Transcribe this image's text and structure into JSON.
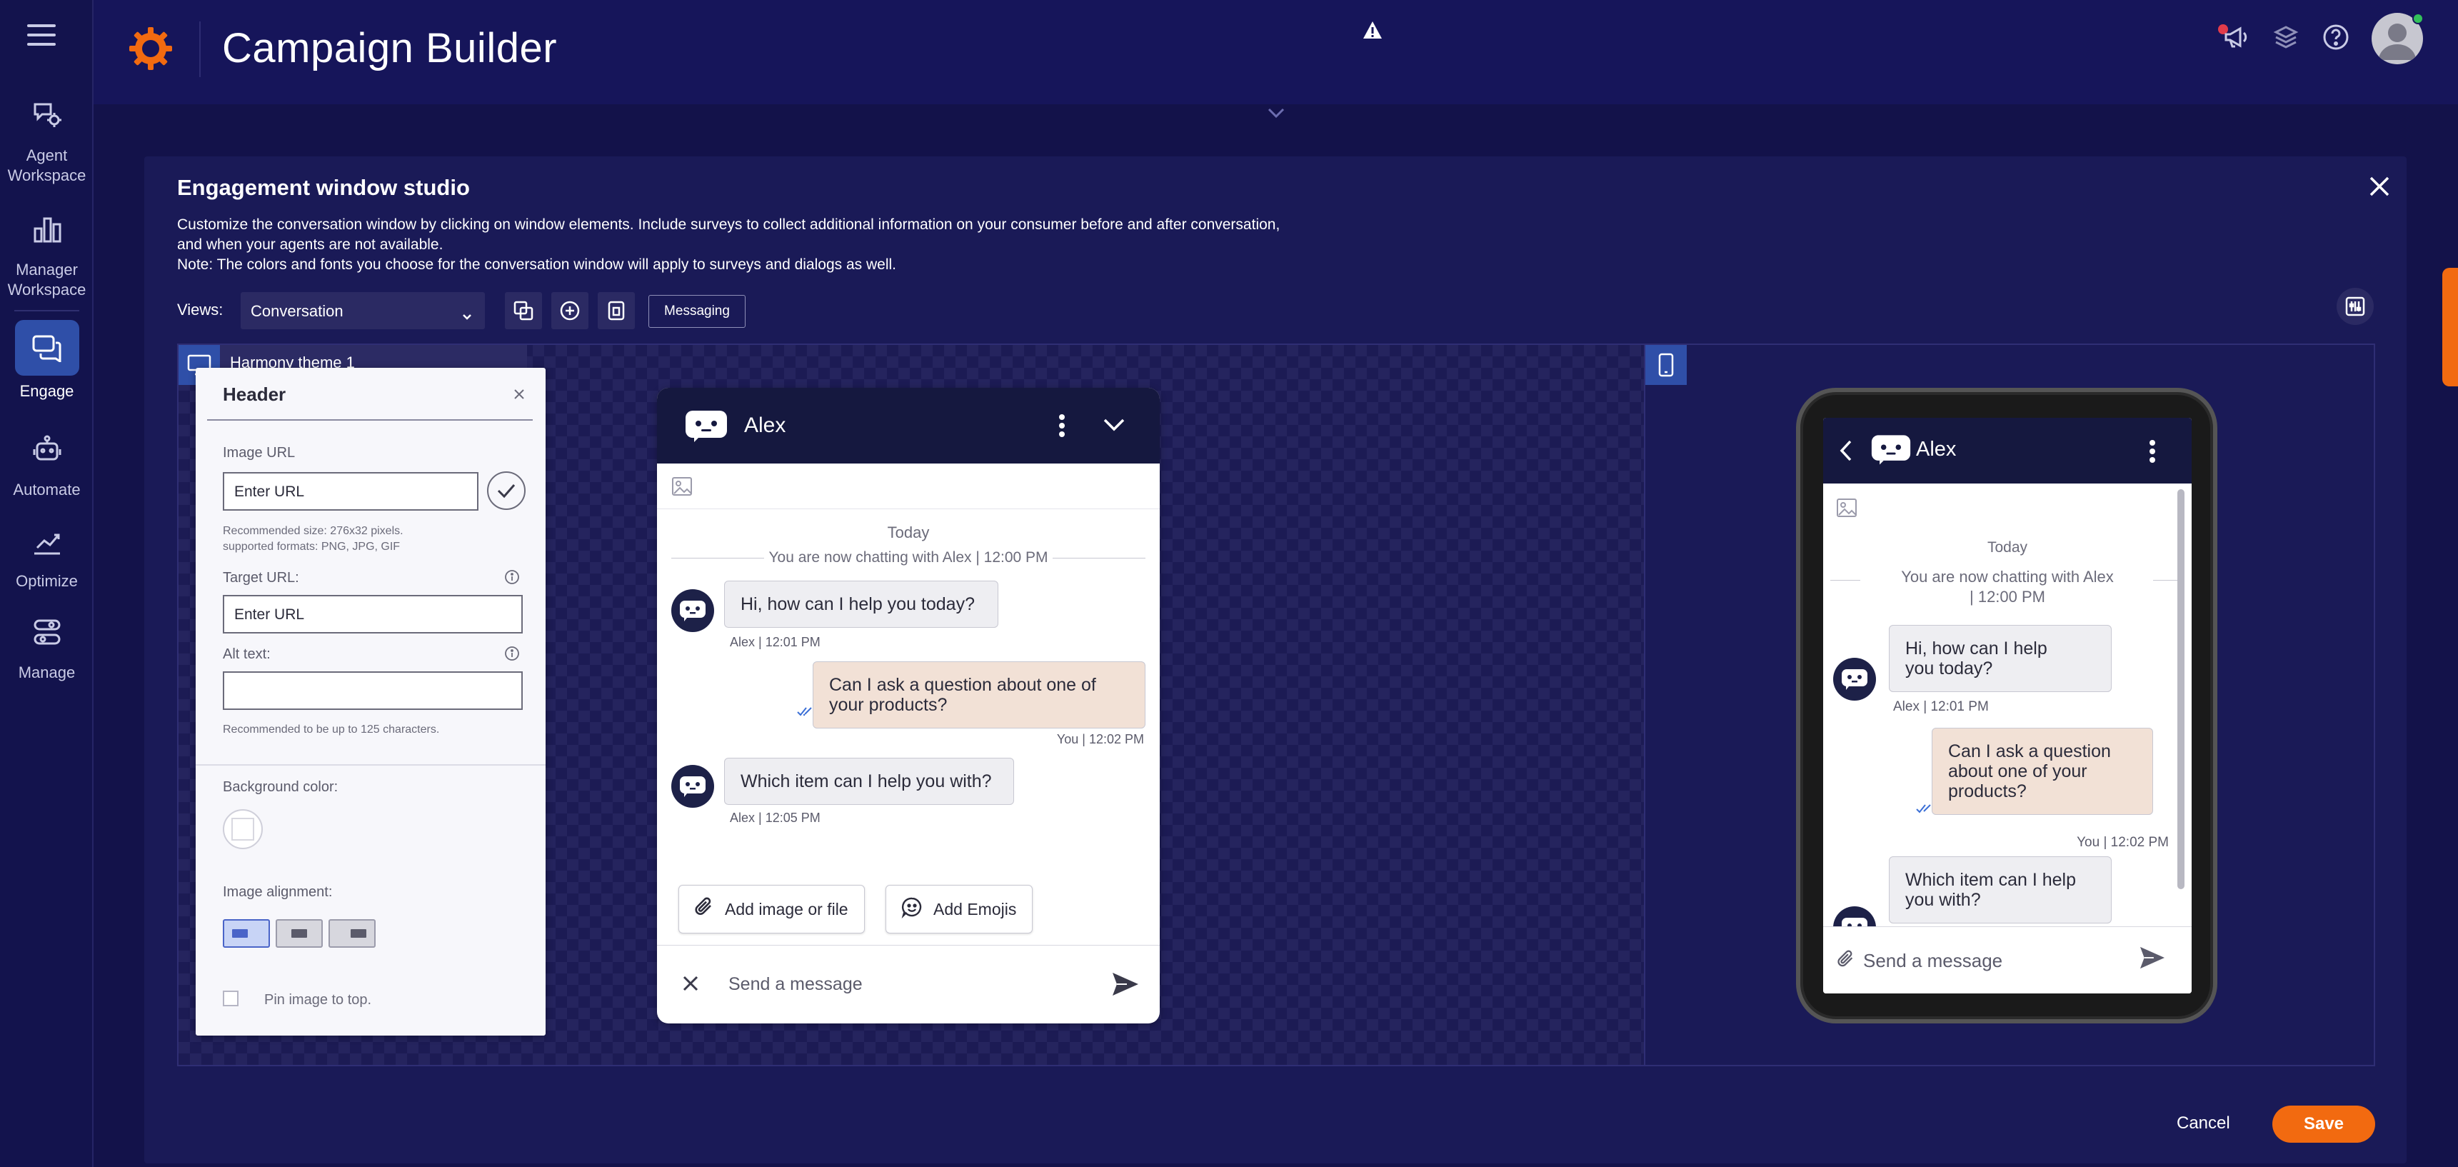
{
  "app": {
    "title": "Campaign Builder"
  },
  "nav": {
    "items": [
      {
        "label": "Agent Workspace",
        "icon": "agent-workspace-icon"
      },
      {
        "label": "Manager Workspace",
        "icon": "bar-chart-icon"
      },
      {
        "label": "Engage",
        "icon": "chat-icon",
        "active": true
      },
      {
        "label": "Automate",
        "icon": "robot-icon"
      },
      {
        "label": "Optimize",
        "icon": "trend-chart-icon"
      },
      {
        "label": "Manage",
        "icon": "toggles-icon"
      }
    ]
  },
  "studio": {
    "title": "Engagement window studio",
    "desc_line1": "Customize the conversation window by clicking on window elements. Include surveys to collect additional information on your consumer before and after conversation, and when your agents are not available.",
    "desc_line2": "Note: The colors and fonts you choose for the conversation window will apply to surveys and dialogs as well.",
    "views_label": "Views:",
    "views_value": "Conversation",
    "messaging_label": "Messaging",
    "theme_name": "Harmony theme 1",
    "cancel_label": "Cancel",
    "save_label": "Save",
    "accent": "#f26a10"
  },
  "editor": {
    "title": "Header",
    "image_url_label": "Image URL",
    "image_url_value": "Enter URL",
    "image_hint_1": "Recommended size: 276x32 pixels.",
    "image_hint_2": "supported formats: PNG, JPG, GIF",
    "target_url_label": "Target URL:",
    "target_url_value": "Enter URL",
    "alt_text_label": "Alt text:",
    "alt_text_value": "",
    "alt_hint": "Recommended to be up to 125 characters.",
    "bg_color_label": "Background color:",
    "alignment_label": "Image alignment:",
    "pin_label": "Pin image to top."
  },
  "chat": {
    "agent_name": "Alex",
    "day": "Today",
    "system_msg": "You are now chatting with Alex | 12:00 PM",
    "system_msg_phone_1": "You are now chatting with Alex",
    "system_msg_phone_2": "| 12:00 PM",
    "messages": [
      {
        "text": "Hi, how can I help you today?",
        "meta": "Alex | 12:01 PM"
      },
      {
        "text_1": "Can I ask a question about one of",
        "text_2": "your products?",
        "meta": "You | 12:02 PM"
      },
      {
        "text": "Which item can I help you with?",
        "meta": "Alex | 12:05 PM"
      }
    ],
    "phone_messages": [
      {
        "line1": "Hi, how can I help",
        "line2": "you today?",
        "meta": "Alex | 12:01 PM"
      },
      {
        "line1": "Can I ask a question",
        "line2": "about one of your",
        "line3": "products?",
        "meta": "You | 12:02 PM"
      },
      {
        "line1": "Which item can I help",
        "line2": "you with?"
      }
    ],
    "add_file_label": "Add image or file",
    "add_emoji_label": "Add Emojis",
    "composer_placeholder": "Send a message"
  }
}
